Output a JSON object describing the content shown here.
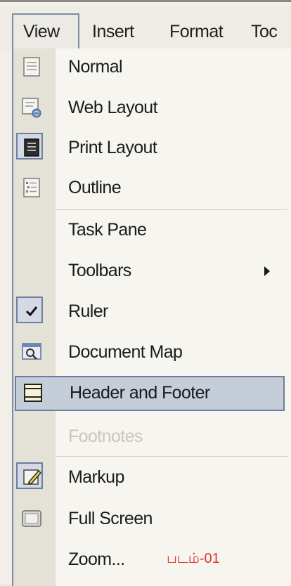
{
  "menubar": {
    "items": [
      {
        "label": "View",
        "active": true
      },
      {
        "label": "Insert"
      },
      {
        "label": "Format"
      },
      {
        "label": "Toc"
      }
    ]
  },
  "view_menu": {
    "items": [
      {
        "label": "Normal",
        "icon": "normal-view-icon"
      },
      {
        "label": "Web Layout",
        "icon": "web-layout-icon"
      },
      {
        "label": "Print Layout",
        "icon": "print-layout-icon",
        "selected": true
      },
      {
        "label": "Outline",
        "icon": "outline-view-icon"
      },
      {
        "label": "Task Pane"
      },
      {
        "label": "Toolbars",
        "submenu": true
      },
      {
        "label": "Ruler",
        "icon": "checkmark-icon",
        "checked": true
      },
      {
        "label": "Document Map",
        "icon": "document-map-icon"
      },
      {
        "label": "Header and Footer",
        "icon": "header-footer-icon",
        "highlighted": true
      },
      {
        "label": "Footnotes",
        "disabled": true
      },
      {
        "label": "Markup",
        "icon": "markup-icon",
        "selected": true
      },
      {
        "label": "Full Screen",
        "icon": "full-screen-icon"
      },
      {
        "label": "Zoom...",
        "caption": "படம்-01"
      }
    ]
  },
  "colors": {
    "highlight": "#c5cdd8",
    "highlight_border": "#6d7ea3",
    "caption": "#e0342a",
    "disabled_text": "#c9c6bd"
  }
}
